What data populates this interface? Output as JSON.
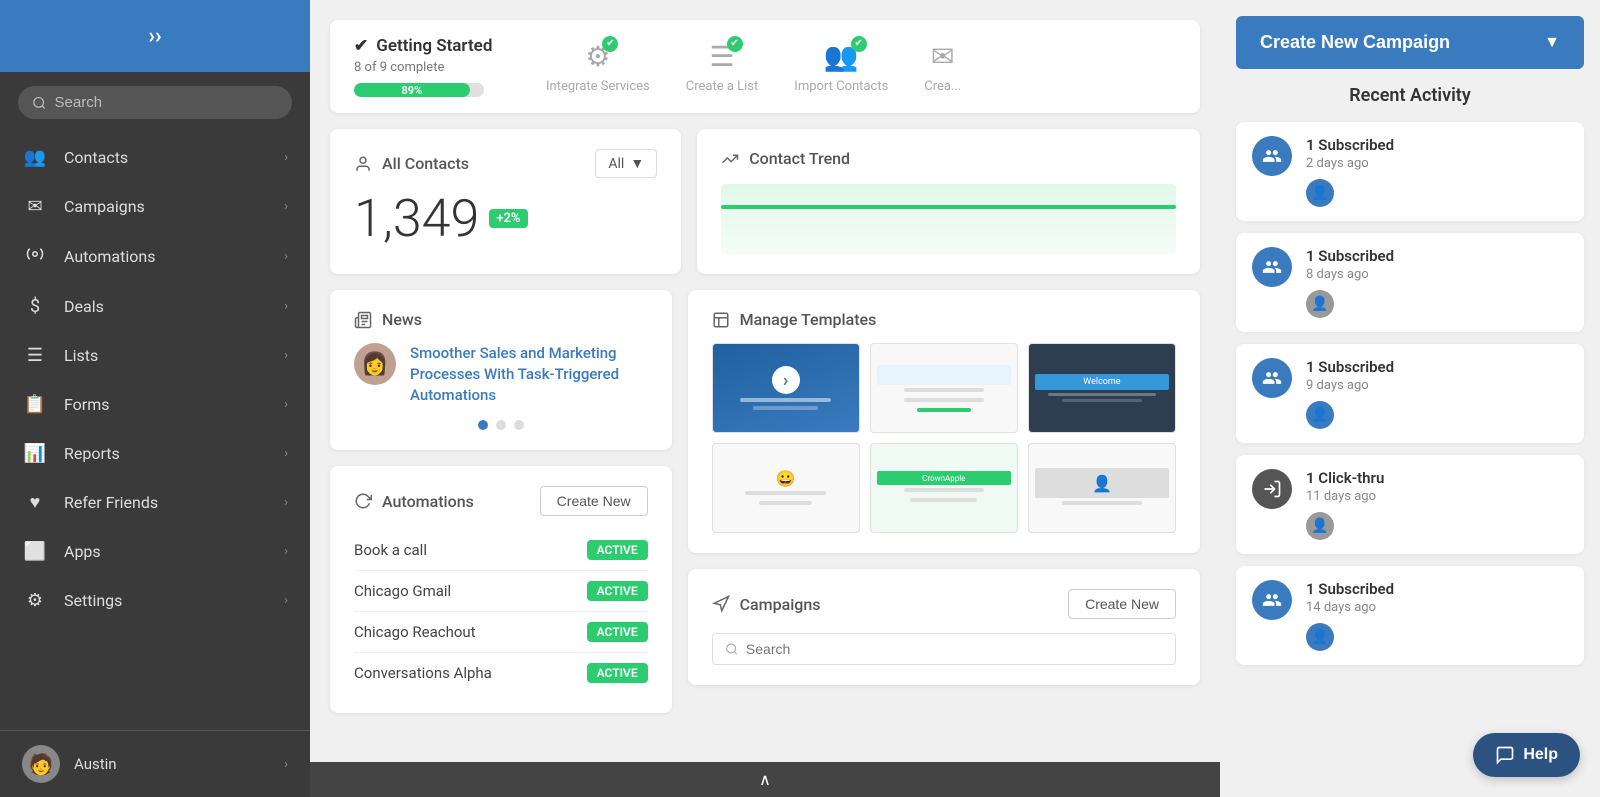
{
  "sidebar": {
    "logo_arrow": "»",
    "search_placeholder": "Search",
    "nav_items": [
      {
        "label": "Contacts",
        "icon": "👥",
        "id": "contacts"
      },
      {
        "label": "Campaigns",
        "icon": "✉",
        "id": "campaigns"
      },
      {
        "label": "Automations",
        "icon": "⚙",
        "id": "automations"
      },
      {
        "label": "Deals",
        "icon": "$",
        "id": "deals"
      },
      {
        "label": "Lists",
        "icon": "≡",
        "id": "lists"
      },
      {
        "label": "Forms",
        "icon": "📋",
        "id": "forms"
      },
      {
        "label": "Reports",
        "icon": "📊",
        "id": "reports"
      },
      {
        "label": "Refer Friends",
        "icon": "♥",
        "id": "refer"
      },
      {
        "label": "Apps",
        "icon": "⬜",
        "id": "apps"
      },
      {
        "label": "Settings",
        "icon": "⚙",
        "id": "settings"
      }
    ],
    "user_name": "Austin"
  },
  "getting_started": {
    "title": "Getting Started",
    "subtitle": "8 of 9 complete",
    "progress_pct": 89,
    "progress_label": "89%",
    "steps": [
      {
        "label": "Integrate Services",
        "icon": "⚙",
        "has_check": true
      },
      {
        "label": "Create a List",
        "icon": "≡",
        "has_check": true
      },
      {
        "label": "Import Contacts",
        "icon": "👥",
        "has_check": true
      },
      {
        "label": "Crea...",
        "icon": "✉",
        "has_check": false
      }
    ]
  },
  "all_contacts": {
    "title": "All Contacts",
    "count": "1,349",
    "badge": "+2%",
    "filter": "All"
  },
  "contact_trend": {
    "title": "Contact Trend"
  },
  "news": {
    "title": "News",
    "article_title": "Smoother Sales and Marketing Processes With Task-Triggered Automations",
    "dots": [
      {
        "active": true
      },
      {
        "active": false
      },
      {
        "active": false
      }
    ]
  },
  "automations": {
    "title": "Automations",
    "create_new_label": "Create New",
    "items": [
      {
        "name": "Book a call",
        "status": "ACTIVE"
      },
      {
        "name": "Chicago Gmail",
        "status": "ACTIVE"
      },
      {
        "name": "Chicago Reachout",
        "status": "ACTIVE"
      },
      {
        "name": "Conversations Alpha",
        "status": "ACTIVE"
      }
    ]
  },
  "manage_templates": {
    "title": "Manage Templates"
  },
  "campaigns": {
    "title": "Campaigns",
    "create_new_label": "Create New",
    "search_placeholder": "Search"
  },
  "recent_activity": {
    "title": "Recent Activity",
    "items": [
      {
        "label": "1 Subscribed",
        "time": "2 days ago",
        "icon_type": "people",
        "avatar_gray": false
      },
      {
        "label": "1 Subscribed",
        "time": "8 days ago",
        "icon_type": "people",
        "avatar_gray": true
      },
      {
        "label": "1 Subscribed",
        "time": "9 days ago",
        "icon_type": "people",
        "avatar_gray": false
      },
      {
        "label": "1 Click-thru",
        "time": "11 days ago",
        "icon_type": "clickthru",
        "avatar_gray": true
      },
      {
        "label": "1 Subscribed",
        "time": "14 days ago",
        "icon_type": "people",
        "avatar_gray": false
      }
    ]
  },
  "create_campaign": {
    "label": "Create New Campaign",
    "dropdown_arrow": "▼"
  },
  "help": {
    "label": "Help"
  },
  "scroll_up_label": "∧"
}
